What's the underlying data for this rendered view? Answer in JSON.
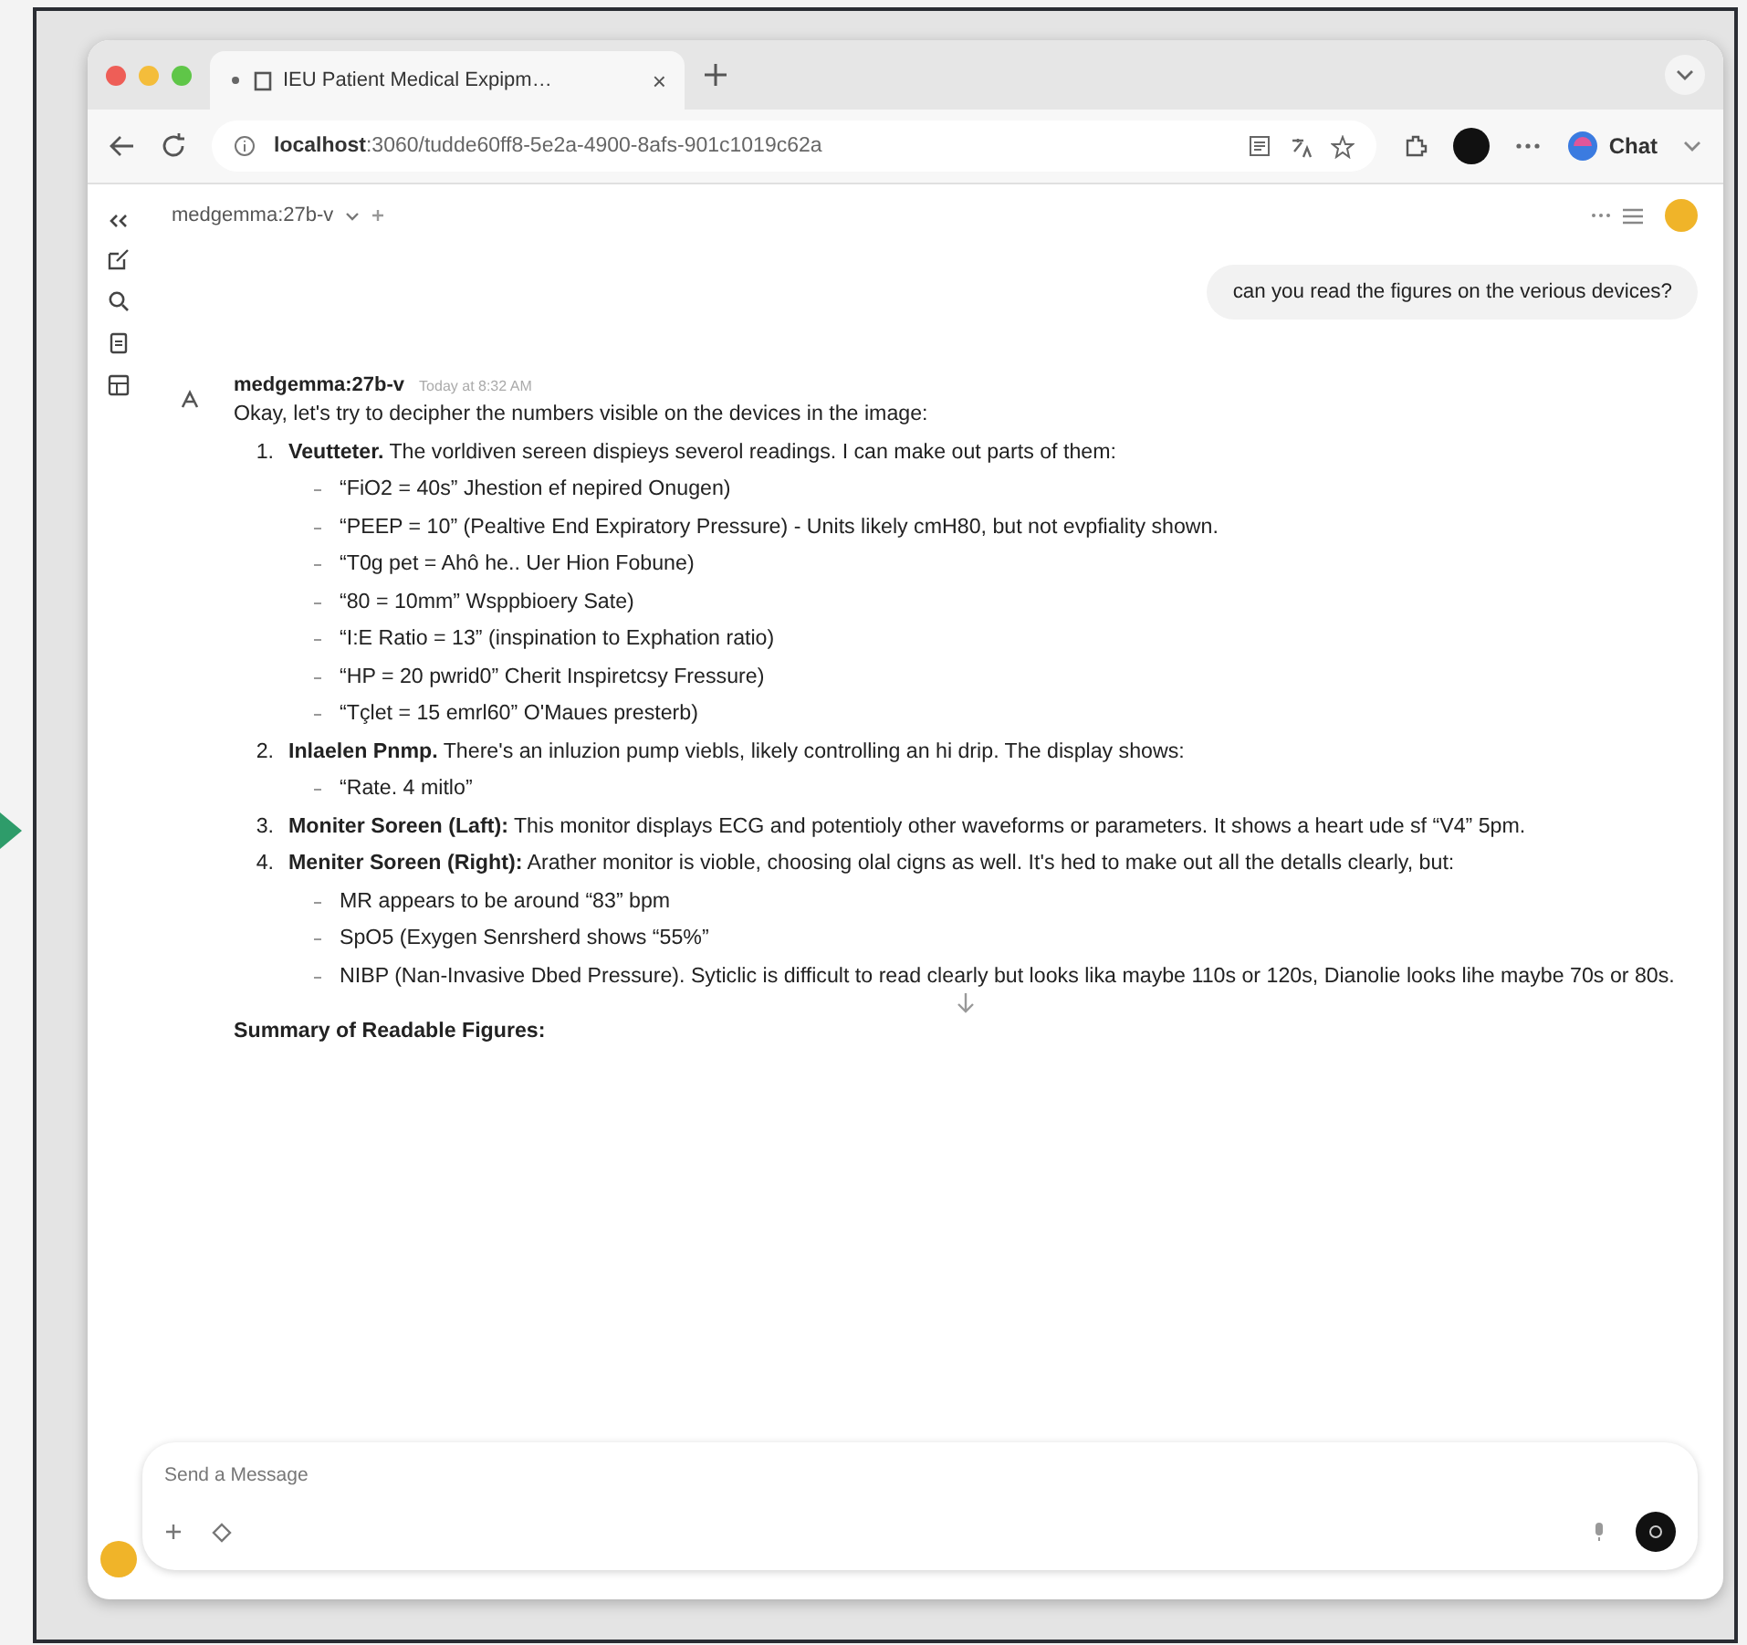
{
  "browser": {
    "tab_title": "IEU Patient Medical Expipm…",
    "tab_close": "×",
    "url_host": "localhost",
    "url_path": ":3060/tudde60ff8-5e2a-4900-8afs-901c1019c62a",
    "chat_button": "Chat"
  },
  "chat": {
    "model": "medgemma:27b-v",
    "user_message": "can you read the figures on the verious devices?",
    "assistant": {
      "name": "medgemma:27b-v",
      "time": "Today at 8:32 AM",
      "intro": "Okay, let's try to decipher the numbers visible on the devices in the image:",
      "items": [
        {
          "number": "1.",
          "text": "**Veutteter.** The vorldiven sereen dispieys severol readings. I can make out parts of them:",
          "subitems": [
            "“FiO2 = 40s” Jhestion ef nepired Onugen)",
            "“PEEP = 10” (Pealtive End Expiratory Pressure) - Units likely cmH80, but not evpfiality shown.",
            "“T0g pet = Ahô he.. Uer Hion Fobune)",
            "“80 = 10mm” Wsppbioery Sate)",
            "“I:E Ratio = 13” (inspination to Exphation ratio)",
            "“HP = 20 pwrid0” Cherit Inspiretcsy Fressure)",
            "“Tçlet = 15 emrl60” O'Maues presterb)"
          ]
        },
        {
          "number": "2.",
          "text": "**Inlaelen Pnmp.** There's an inluzion pump viebls, likely controlling an hi drip. The display shows:",
          "subitems": [
            "“Rate. 4 mitlo”"
          ]
        },
        {
          "number": "3.",
          "text": "**Moniter Soreen (Laft):** This monitor displays ECG and potentioly other waveforms or parameters. It shows a heart ude sf “V4” 5pm."
        },
        {
          "number": "4.",
          "text": "**Meniter Soreen (Right):** Arather monitor is vioble, choosing olal cigns as well. It's hed to make out all the detalls clearly, but:",
          "subitems": [
            "MR appears to be around “83” bpm",
            "SpO5 (Exygen Senrsherd shows “55%”",
            "NIBP (Nan-Invasive Dbed Pressure). Syticlic is difficult to read clearly but looks lika maybe 110s or 120s, Dianolie looks lihe maybe 70s or 80s."
          ]
        }
      ],
      "summary": "Summary of Readable Figures:"
    },
    "input_placeholder": "Send a Message"
  }
}
